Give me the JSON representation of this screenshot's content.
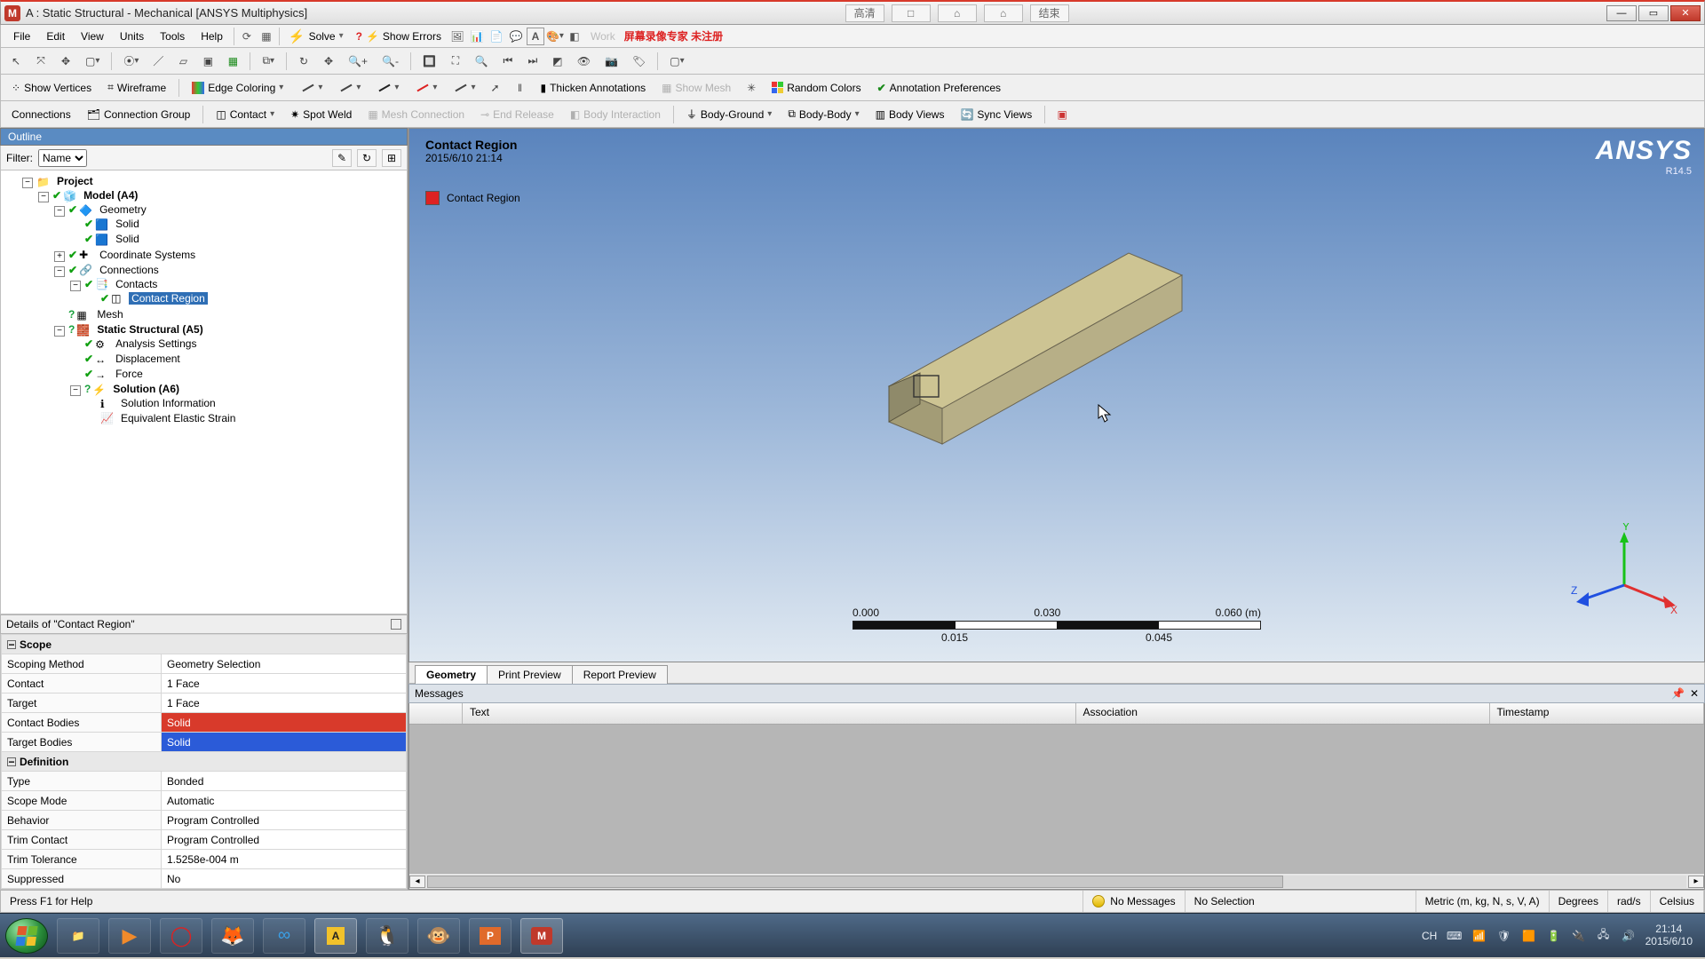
{
  "window": {
    "title": "A : Static Structural - Mechanical [ANSYS Multiphysics]",
    "center_buttons": [
      "高清",
      "□",
      "⌂",
      "⌂",
      "结束"
    ]
  },
  "menus": [
    "File",
    "Edit",
    "View",
    "Units",
    "Tools",
    "Help"
  ],
  "menu_extras": {
    "solve": "Solve",
    "show_errors": "Show Errors",
    "workbench_grey": "Work",
    "red_note": "屏幕录像专家  未注册"
  },
  "toolbar2": {
    "show_vertices": "Show Vertices",
    "wireframe": "Wireframe",
    "edge_coloring": "Edge Coloring",
    "thicken": "Thicken Annotations",
    "show_mesh": "Show Mesh",
    "random_colors": "Random Colors",
    "annotation_prefs": "Annotation Preferences"
  },
  "toolbar3": {
    "connections": "Connections",
    "connection_group": "Connection Group",
    "contact": "Contact",
    "spot_weld": "Spot Weld",
    "mesh_connection": "Mesh Connection",
    "end_release": "End Release",
    "body_interaction": "Body Interaction",
    "body_ground": "Body-Ground",
    "body_body": "Body-Body",
    "body_views": "Body Views",
    "sync_views": "Sync Views"
  },
  "outline": {
    "header": "Outline",
    "filter_label": "Filter:",
    "filter_value": "Name",
    "tree": {
      "project": "Project",
      "model": "Model (A4)",
      "geometry": "Geometry",
      "solid1": "Solid",
      "solid2": "Solid",
      "coord": "Coordinate Systems",
      "connections": "Connections",
      "contacts": "Contacts",
      "contact_region": "Contact Region",
      "mesh": "Mesh",
      "static": "Static Structural (A5)",
      "analysis_settings": "Analysis Settings",
      "displacement": "Displacement",
      "force": "Force",
      "solution": "Solution (A6)",
      "solution_info": "Solution Information",
      "eq_elastic": "Equivalent Elastic Strain"
    }
  },
  "details": {
    "header": "Details of \"Contact Region\"",
    "groups": {
      "scope": "Scope",
      "definition": "Definition"
    },
    "rows": {
      "scoping_method": {
        "k": "Scoping Method",
        "v": "Geometry Selection"
      },
      "contact": {
        "k": "Contact",
        "v": "1 Face"
      },
      "target": {
        "k": "Target",
        "v": "1 Face"
      },
      "contact_bodies": {
        "k": "Contact Bodies",
        "v": "Solid"
      },
      "target_bodies": {
        "k": "Target Bodies",
        "v": "Solid"
      },
      "type": {
        "k": "Type",
        "v": "Bonded"
      },
      "scope_mode": {
        "k": "Scope Mode",
        "v": "Automatic"
      },
      "behavior": {
        "k": "Behavior",
        "v": "Program Controlled"
      },
      "trim_contact": {
        "k": "Trim Contact",
        "v": "Program Controlled"
      },
      "trim_tol": {
        "k": "Trim Tolerance",
        "v": "1.5258e-004 m"
      },
      "suppressed": {
        "k": "Suppressed",
        "v": "No"
      }
    }
  },
  "viewport": {
    "title": "Contact Region",
    "timestamp": "2015/6/10 21:14",
    "legend": "Contact Region",
    "logo": "ANSYS",
    "logo_sub": "R14.5",
    "scale": {
      "t0": "0.000",
      "t1": "0.030",
      "t2": "0.060 (m)",
      "b0": "0.015",
      "b1": "0.045"
    },
    "triad": {
      "x": "X",
      "y": "Y",
      "z": "Z"
    }
  },
  "vp_tabs": {
    "geometry": "Geometry",
    "print": "Print Preview",
    "report": "Report Preview"
  },
  "messages": {
    "header": "Messages",
    "cols": {
      "text": "Text",
      "association": "Association",
      "timestamp": "Timestamp"
    }
  },
  "status": {
    "help": "Press F1 for Help",
    "no_messages": "No Messages",
    "no_selection": "No Selection",
    "units": "Metric (m, kg, N, s, V, A)",
    "degrees": "Degrees",
    "rads": "rad/s",
    "celsius": "Celsius"
  },
  "taskbar": {
    "lang": "CH",
    "time": "21:14",
    "date": "2015/6/10"
  }
}
